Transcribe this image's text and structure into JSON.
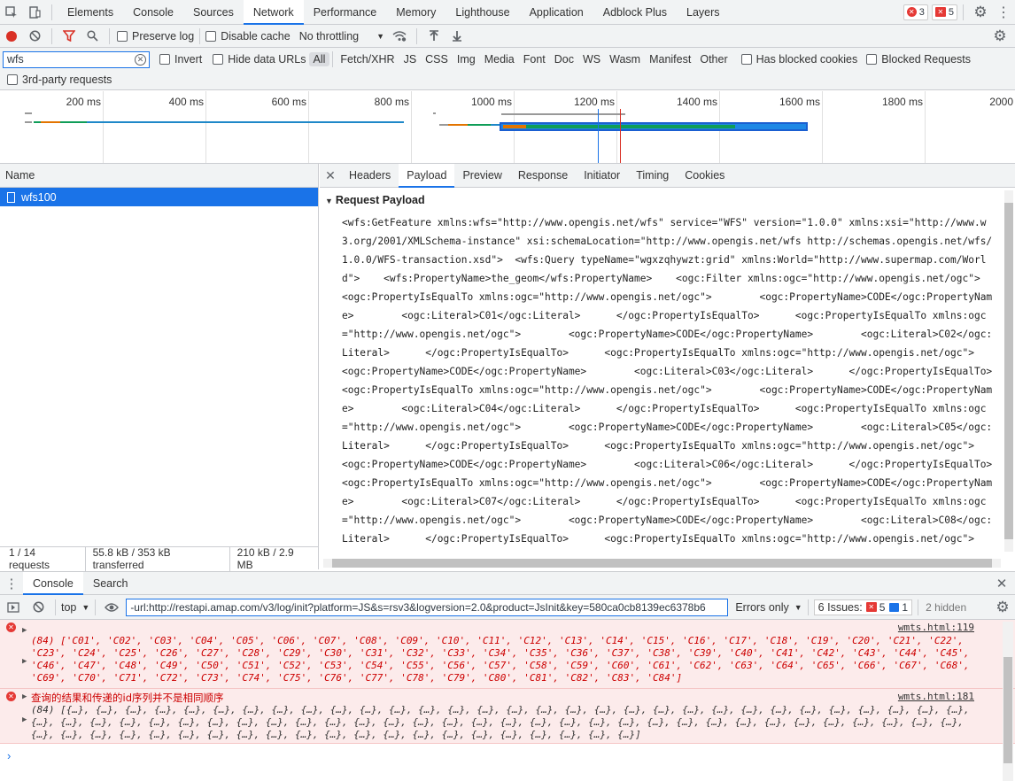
{
  "tabs": [
    "Elements",
    "Console",
    "Sources",
    "Network",
    "Performance",
    "Memory",
    "Lighthouse",
    "Application",
    "Adblock Plus",
    "Layers"
  ],
  "badges": {
    "errors": "3",
    "issues": "5"
  },
  "toolbar": {
    "preserve_log": "Preserve log",
    "disable_cache": "Disable cache",
    "throttling": "No throttling"
  },
  "filter": {
    "value": "wfs",
    "invert": "Invert",
    "hide_data_urls": "Hide data URLs",
    "types": [
      "All",
      "Fetch/XHR",
      "JS",
      "CSS",
      "Img",
      "Media",
      "Font",
      "Doc",
      "WS",
      "Wasm",
      "Manifest",
      "Other"
    ],
    "blocked_cookies": "Has blocked cookies",
    "blocked_requests": "Blocked Requests",
    "third_party": "3rd-party requests"
  },
  "overview": {
    "ticks": [
      "200 ms",
      "400 ms",
      "600 ms",
      "800 ms",
      "1000 ms",
      "1200 ms",
      "1400 ms",
      "1600 ms",
      "1800 ms",
      "2000"
    ]
  },
  "requests": {
    "header": "Name",
    "items": [
      "wfs100"
    ]
  },
  "status": {
    "count": "1 / 14 requests",
    "transferred": "55.8 kB / 353 kB transferred",
    "resources": "210 kB / 2.9 MB"
  },
  "detail": {
    "tabs": [
      "Headers",
      "Payload",
      "Preview",
      "Response",
      "Initiator",
      "Timing",
      "Cookies"
    ],
    "payload_title": "Request Payload",
    "payload": "<wfs:GetFeature xmlns:wfs=\"http://www.opengis.net/wfs\" service=\"WFS\" version=\"1.0.0\" xmlns:xsi=\"http://www.w3.org/2001/XMLSchema-instance\" xsi:schemaLocation=\"http://www.opengis.net/wfs http://schemas.opengis.net/wfs/1.0.0/WFS-transaction.xsd\">  <wfs:Query typeName=\"wgxzqhywzt:grid\" xmlns:World=\"http://www.supermap.com/World\">    <wfs:PropertyName>the_geom</wfs:PropertyName>    <ogc:Filter xmlns:ogc=\"http://www.opengis.net/ogc\">      <ogc:PropertyIsEqualTo xmlns:ogc=\"http://www.opengis.net/ogc\">        <ogc:PropertyName>CODE</ogc:PropertyName>        <ogc:Literal>C01</ogc:Literal>      </ogc:PropertyIsEqualTo>      <ogc:PropertyIsEqualTo xmlns:ogc=\"http://www.opengis.net/ogc\">        <ogc:PropertyName>CODE</ogc:PropertyName>        <ogc:Literal>C02</ogc:Literal>      </ogc:PropertyIsEqualTo>      <ogc:PropertyIsEqualTo xmlns:ogc=\"http://www.opengis.net/ogc\">        <ogc:PropertyName>CODE</ogc:PropertyName>        <ogc:Literal>C03</ogc:Literal>      </ogc:PropertyIsEqualTo>      <ogc:PropertyIsEqualTo xmlns:ogc=\"http://www.opengis.net/ogc\">        <ogc:PropertyName>CODE</ogc:PropertyName>        <ogc:Literal>C04</ogc:Literal>      </ogc:PropertyIsEqualTo>      <ogc:PropertyIsEqualTo xmlns:ogc=\"http://www.opengis.net/ogc\">        <ogc:PropertyName>CODE</ogc:PropertyName>        <ogc:Literal>C05</ogc:Literal>      </ogc:PropertyIsEqualTo>      <ogc:PropertyIsEqualTo xmlns:ogc=\"http://www.opengis.net/ogc\">        <ogc:PropertyName>CODE</ogc:PropertyName>        <ogc:Literal>C06</ogc:Literal>      </ogc:PropertyIsEqualTo>      <ogc:PropertyIsEqualTo xmlns:ogc=\"http://www.opengis.net/ogc\">        <ogc:PropertyName>CODE</ogc:PropertyName>        <ogc:Literal>C07</ogc:Literal>      </ogc:PropertyIsEqualTo>      <ogc:PropertyIsEqualTo xmlns:ogc=\"http://www.opengis.net/ogc\">        <ogc:PropertyName>CODE</ogc:PropertyName>        <ogc:Literal>C08</ogc:Literal>      </ogc:PropertyIsEqualTo>      <ogc:PropertyIsEqualTo xmlns:ogc=\"http://www.opengis.net/ogc\">        <ogc:PropertyName>CODE</ogc:PropertyName>"
  },
  "drawer": {
    "tabs": [
      "Console",
      "Search"
    ]
  },
  "console": {
    "context": "top",
    "filter": "-url:http://restapi.amap.com/v3/log/init?platform=JS&s=rsv3&logversion=2.0&product=JsInit&key=580ca0cb8139ec6378b6",
    "levels": "Errors only",
    "issues_label": "6 Issues:",
    "issues_err": "5",
    "issues_info": "1",
    "hidden": "2 hidden",
    "messages": [
      {
        "source": "wmts.html:119",
        "text": "(84) ['C01', 'C02', 'C03', 'C04', 'C05', 'C06', 'C07', 'C08', 'C09', 'C10', 'C11', 'C12', 'C13', 'C14', 'C15', 'C16', 'C17', 'C18', 'C19', 'C20', 'C21', 'C22', 'C23', 'C24', 'C25', 'C26', 'C27', 'C28', 'C29', 'C30', 'C31', 'C32', 'C33', 'C34', 'C35', 'C36', 'C37', 'C38', 'C39', 'C40', 'C41', 'C42', 'C43', 'C44', 'C45', 'C46', 'C47', 'C48', 'C49', 'C50', 'C51', 'C52', 'C53', 'C54', 'C55', 'C56', 'C57', 'C58', 'C59', 'C60', 'C61', 'C62', 'C63', 'C64', 'C65', 'C66', 'C67', 'C68', 'C69', 'C70', 'C71', 'C72', 'C73', 'C74', 'C75', 'C76', 'C77', 'C78', 'C79', 'C80', 'C81', 'C82', 'C83', 'C84']"
      },
      {
        "source": "wmts.html:181",
        "title": "查询的结果和传递的id序列并不是相同顺序",
        "text": "(84) [{…}, {…}, {…}, {…}, {…}, {…}, {…}, {…}, {…}, {…}, {…}, {…}, {…}, {…}, {…}, {…}, {…}, {…}, {…}, {…}, {…}, {…}, {…}, {…}, {…}, {…}, {…}, {…}, {…}, {…}, {…}, {…}, {…}, {…}, {…}, {…}, {…}, {…}, {…}, {…}, {…}, {…}, {…}, {…}, {…}, {…}, {…}, {…}, {…}, {…}, {…}, {…}, {…}, {…}, {…}, {…}, {…}, {…}, {…}, {…}, {…}, {…}, {…}, {…}, {…}, {…}, {…}, {…}, {…}, {…}, {…}, {…}, {…}, {…}, {…}, {…}, {…}, {…}, {…}, {…}, {…}, {…}, {…}, {…}]"
      }
    ]
  }
}
